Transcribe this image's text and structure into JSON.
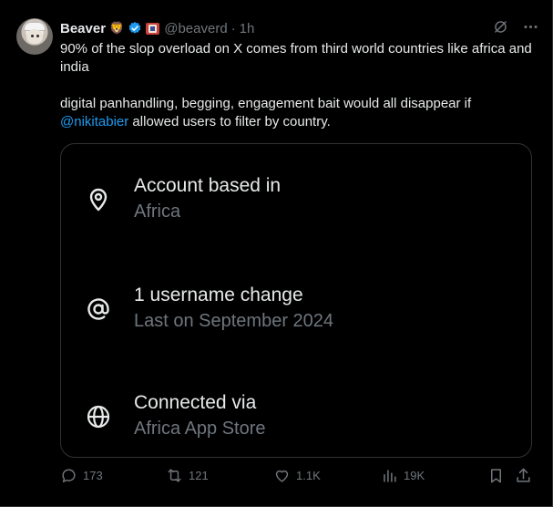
{
  "author": {
    "name": "Beaver",
    "emoji": "🦁",
    "handle": "@beaverd",
    "separator": "·",
    "time": "1h"
  },
  "tweet": {
    "line1": "90% of the slop overload on X comes from third world countries like africa and india",
    "line2_before": "digital panhandling, begging, engagement bait would all disappear if ",
    "mention": "@nikitabier",
    "line2_after": " allowed users to filter by country."
  },
  "card": {
    "rows": [
      {
        "icon": "location-pin-icon",
        "title": "Account based in",
        "subtitle": "Africa"
      },
      {
        "icon": "at-sign-icon",
        "title": "1 username change",
        "subtitle": "Last on September 2024"
      },
      {
        "icon": "globe-icon",
        "title": "Connected via",
        "subtitle": "Africa App Store"
      }
    ]
  },
  "actions": {
    "replies": "173",
    "reposts": "121",
    "likes": "1.1K",
    "views": "19K"
  },
  "colors": {
    "background": "#000000",
    "text": "#e7e9ea",
    "muted": "#71767b",
    "link": "#1d9bf0",
    "verified": "#1d9bf0",
    "border": "#2f3336"
  }
}
